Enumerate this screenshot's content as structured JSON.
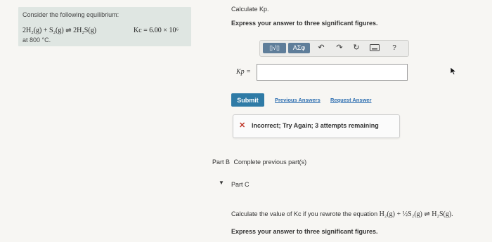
{
  "problem": {
    "intro": "Consider the following equilibrium:",
    "equation": "2H₂(g) + S₂(g) ⇌ 2H₂S(g)",
    "kc_value": "Kc = 6.00 × 10⁶",
    "temperature": "at 800 °C."
  },
  "part_a": {
    "prompt": "Calculate Kp.",
    "instruction": "Express your answer to three significant figures.",
    "toolbar": {
      "templates_label": "▯√▯",
      "greek_label": "ΑΣφ",
      "help_label": "?"
    },
    "answer_label": "Kp =",
    "answer_value": "",
    "submit_label": "Submit",
    "previous_answers_label": "Previous Answers",
    "request_answer_label": "Request Answer",
    "feedback_icon": "✕",
    "feedback_text": "Incorrect; Try Again; 3 attempts remaining"
  },
  "part_b": {
    "label": "Part B",
    "status": "Complete previous part(s)"
  },
  "part_c": {
    "label": "Part C",
    "prompt_prefix": "Calculate the value of Kc if you rewrote the equation",
    "equation": "H₂(g) + ½S₂(g) ⇌ H₂S(g).",
    "instruction": "Express your answer to three significant figures."
  },
  "colors": {
    "submit_bg": "#2f7ba6",
    "link": "#2b6db0",
    "error": "#c0392b",
    "problem_bg": "#dfe6e2"
  }
}
